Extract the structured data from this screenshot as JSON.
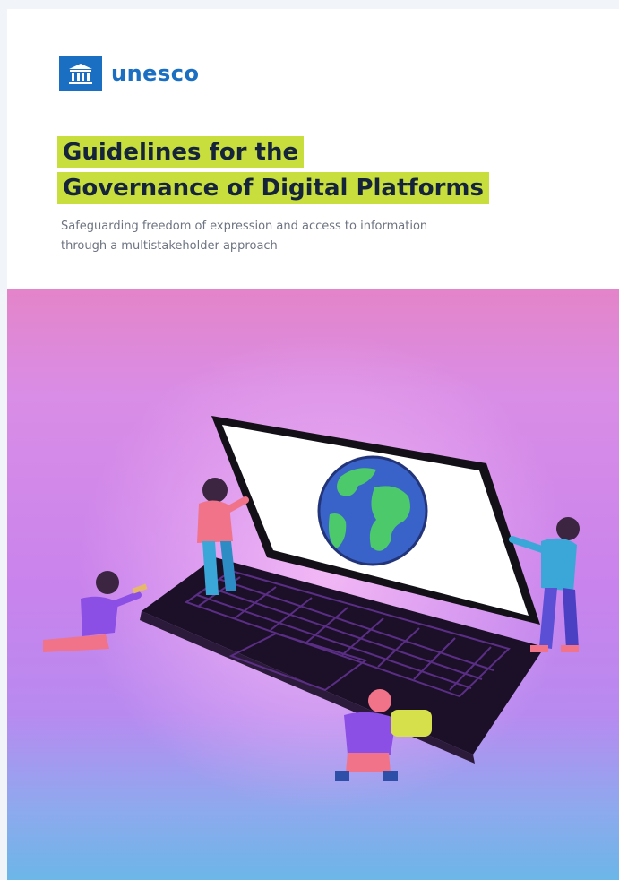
{
  "publisher": {
    "logo_text": "unesco",
    "logo_icon": "temple-building-icon",
    "brand_color": "#1b6fc2"
  },
  "cover": {
    "title_lines": [
      "Guidelines for the",
      "Governance of Digital Platforms"
    ],
    "title_highlight_color": "#c8de3c",
    "subtitle_lines": [
      "Safeguarding freedom of expression and access to information",
      "through a multistakeholder approach"
    ]
  },
  "illustration": {
    "subject": "laptop-with-globe-illustration"
  }
}
